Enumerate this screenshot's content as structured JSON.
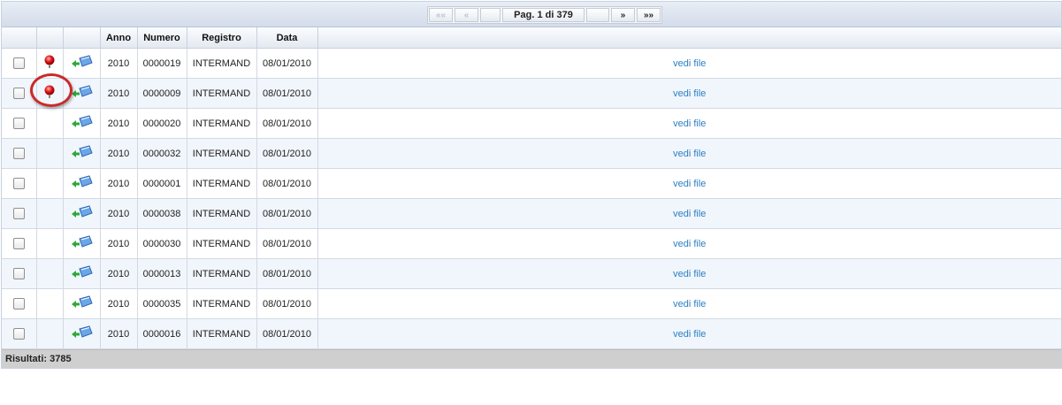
{
  "pager": {
    "first_label": "««",
    "prev_label": "«",
    "info": "Pag. 1 di 379",
    "next_label": "»",
    "last_label": "»»"
  },
  "columns": [
    "",
    "",
    "",
    "Anno",
    "Numero",
    "Registro",
    "Data",
    ""
  ],
  "rows": [
    {
      "anno": "2010",
      "numero": "0000019",
      "registro": "INTERMAND",
      "data": "08/01/2010",
      "link": "vedi file",
      "has_bulb": true,
      "highlighted": false
    },
    {
      "anno": "2010",
      "numero": "0000009",
      "registro": "INTERMAND",
      "data": "08/01/2010",
      "link": "vedi file",
      "has_bulb": true,
      "highlighted": true
    },
    {
      "anno": "2010",
      "numero": "0000020",
      "registro": "INTERMAND",
      "data": "08/01/2010",
      "link": "vedi file",
      "has_bulb": false,
      "highlighted": false
    },
    {
      "anno": "2010",
      "numero": "0000032",
      "registro": "INTERMAND",
      "data": "08/01/2010",
      "link": "vedi file",
      "has_bulb": false,
      "highlighted": false
    },
    {
      "anno": "2010",
      "numero": "0000001",
      "registro": "INTERMAND",
      "data": "08/01/2010",
      "link": "vedi file",
      "has_bulb": false,
      "highlighted": false
    },
    {
      "anno": "2010",
      "numero": "0000038",
      "registro": "INTERMAND",
      "data": "08/01/2010",
      "link": "vedi file",
      "has_bulb": false,
      "highlighted": false
    },
    {
      "anno": "2010",
      "numero": "0000030",
      "registro": "INTERMAND",
      "data": "08/01/2010",
      "link": "vedi file",
      "has_bulb": false,
      "highlighted": false
    },
    {
      "anno": "2010",
      "numero": "0000013",
      "registro": "INTERMAND",
      "data": "08/01/2010",
      "link": "vedi file",
      "has_bulb": false,
      "highlighted": false
    },
    {
      "anno": "2010",
      "numero": "0000035",
      "registro": "INTERMAND",
      "data": "08/01/2010",
      "link": "vedi file",
      "has_bulb": false,
      "highlighted": false
    },
    {
      "anno": "2010",
      "numero": "0000016",
      "registro": "INTERMAND",
      "data": "08/01/2010",
      "link": "vedi file",
      "has_bulb": false,
      "highlighted": false
    }
  ],
  "footer": {
    "results": "Risultati: 3785"
  },
  "icons": {
    "row_flag": "red-pin-icon",
    "row_action": "open-document-icon"
  },
  "colors": {
    "link": "#2a7fc4",
    "highlight": "#c92a2a",
    "row_alt": "#f1f6fc"
  }
}
